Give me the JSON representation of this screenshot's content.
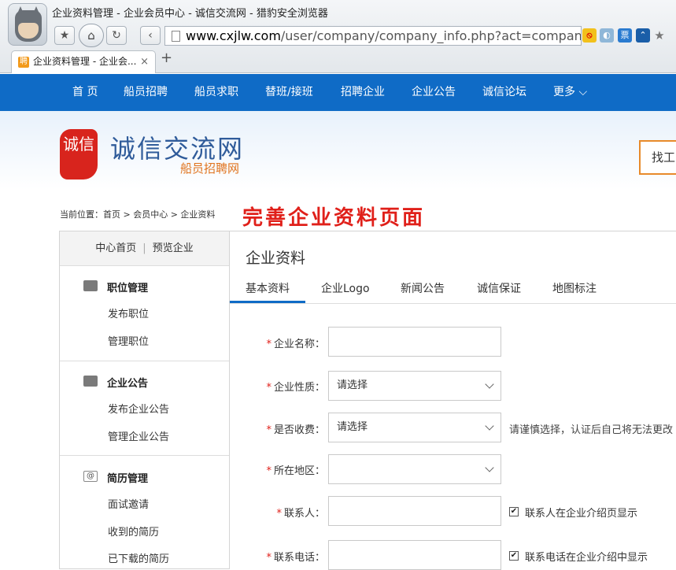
{
  "browser": {
    "window_title": "企业资料管理 - 企业会员中心 - 诚信交流网 - 猎豹安全浏览器",
    "address_domain": "www.cxjlw.com",
    "address_path": "/user/company/company_info.php?act=company_pro",
    "tab_title": "企业资料管理 - 企业会...",
    "tab_favicon": "聘",
    "back": "‹",
    "reload": "↻",
    "star": "★",
    "home": "⌂",
    "close": "×",
    "newtab": "+",
    "ext_ticket": "票"
  },
  "nav": [
    "首 页",
    "船员招聘",
    "船员求职",
    "替班/接班",
    "招聘企业",
    "企业公告",
    "诚信论坛",
    "更多 ⌵"
  ],
  "logo": {
    "seal_text": "诚信",
    "main": "诚信交流网",
    "sub": "船员招聘网"
  },
  "search_box": "找工",
  "breadcrumb": "当前位置：首页 > 会员中心 > 企业资料",
  "annotation": "完善企业资料页面",
  "sidebar": {
    "top_links": [
      "中心首页",
      "预览企业"
    ],
    "top_sep": "|",
    "sections": [
      {
        "title": "职位管理",
        "icon": "folder-icon",
        "links": [
          "发布职位",
          "管理职位"
        ]
      },
      {
        "title": "企业公告",
        "icon": "folder-icon",
        "links": [
          "发布企业公告",
          "管理企业公告"
        ]
      },
      {
        "title": "简历管理",
        "icon": "at-icon",
        "icon_glyph": "@",
        "links": [
          "面试邀请",
          "收到的简历",
          "已下载的简历"
        ]
      }
    ]
  },
  "main": {
    "title": "企业资料",
    "tabs": [
      "基本资料",
      "企业Logo",
      "新闻公告",
      "诚信保证",
      "地图标注"
    ],
    "active_tab": "基本资料",
    "form": {
      "required_mark": "*",
      "name_label": "企业名称：",
      "nature_label": "企业性质：",
      "nature_value": "请选择",
      "charge_label": "是否收费：",
      "charge_value": "请选择",
      "charge_hint": "请谨慎选择，认证后自己将无法更改",
      "region_label": "所在地区：",
      "contact_label": "联系人：",
      "contact_check": "联系人在企业介绍页显示",
      "phone_label": "联系电话：",
      "phone_check": "联系电话在企业介绍中显示",
      "check_mark": "✔"
    }
  }
}
